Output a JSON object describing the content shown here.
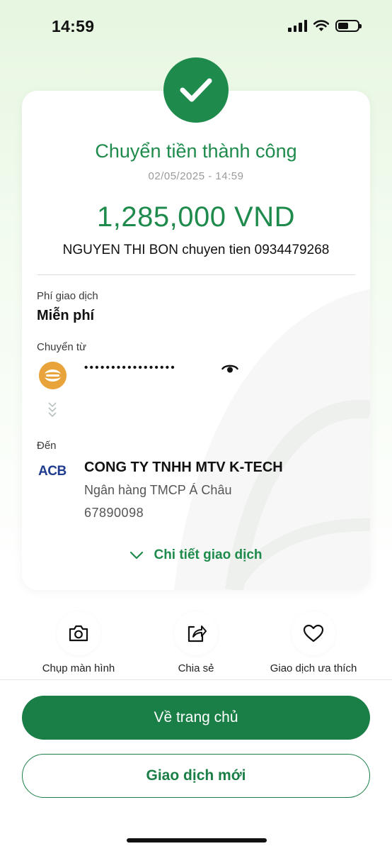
{
  "status_bar": {
    "time": "14:59"
  },
  "result": {
    "title": "Chuyển tiền thành công",
    "datetime": "02/05/2025 - 14:59",
    "amount": "1,285,000 VND",
    "description": "NGUYEN THI BON chuyen tien 0934479268"
  },
  "fee": {
    "label": "Phí giao dịch",
    "value": "Miễn phí"
  },
  "source": {
    "label": "Chuyển từ",
    "account_masked": "•••••••••••••••••"
  },
  "destination": {
    "label": "Đến",
    "bank_logo_text": "ACB",
    "name": "CONG TY TNHH MTV K-TECH",
    "bank": "Ngân hàng TMCP Á Châu",
    "account": "67890098"
  },
  "details_link": "Chi tiết giao dịch",
  "actions": [
    {
      "label": "Chụp màn hình",
      "icon": "camera-icon"
    },
    {
      "label": "Chia sẻ",
      "icon": "share-icon"
    },
    {
      "label": "Giao dịch ưa thích",
      "icon": "heart-icon"
    }
  ],
  "buttons": {
    "home": "Về trang chủ",
    "new_transaction": "Giao dịch mới"
  },
  "colors": {
    "brand_green": "#1e8b4c",
    "button_green": "#1a7f46",
    "acb_blue": "#1f3c8f",
    "source_bank_orange": "#e8a33a"
  }
}
